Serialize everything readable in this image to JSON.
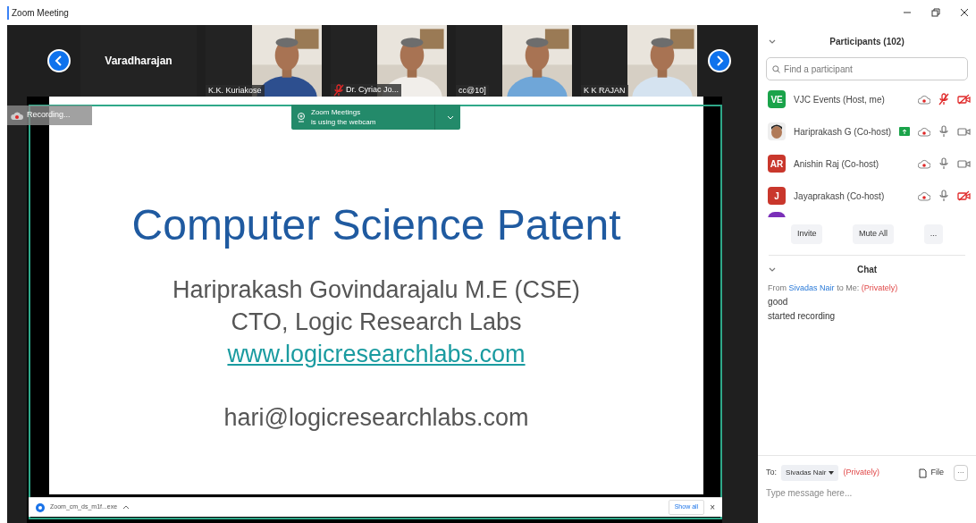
{
  "window": {
    "title": "Zoom Meeting"
  },
  "video_strip": {
    "tiles": [
      {
        "kind": "name",
        "name": "Varadharajan",
        "mic_muted": false
      },
      {
        "kind": "video",
        "name": "K.K. Kuriakose",
        "mic_muted": false
      },
      {
        "kind": "video",
        "name": "Dr. Cyriac Jo...",
        "mic_muted": true
      },
      {
        "kind": "video",
        "name": "cc@10]",
        "mic_muted": false
      },
      {
        "kind": "video",
        "name": "K K RAJAN",
        "mic_muted": false
      }
    ]
  },
  "recording_badge": {
    "label": "Recording..."
  },
  "webcam_notice": {
    "line_1": "Zoom Meetings",
    "line_2": "is using the webcam"
  },
  "slide": {
    "title": "Computer Science Patent",
    "lines": [
      "Hariprakash Govindarajalu M.E (CSE)",
      "CTO, Logic Research Labs"
    ],
    "link": "www.logicresearchlabs.com",
    "email": "hari@logicresearchlabs.com"
  },
  "download_bar": {
    "file": "Zoom_cm_ds_m1f...exe",
    "show_all": "Show all",
    "close": "×"
  },
  "participants": {
    "title": "Participants (102)",
    "search": {
      "placeholder": "Find a participant"
    },
    "items": [
      {
        "kind": "initials",
        "initials": "VE",
        "color": "#1aa34a",
        "name": "VJC Events (Host, me)",
        "sharing": false,
        "mic_muted": true,
        "video_off": true
      },
      {
        "name": "Hariprakash G (Co-host)",
        "sharing": true,
        "mic_muted": false,
        "video_off": false
      },
      {
        "kind": "initials",
        "initials": "AR",
        "color": "#c9372c",
        "name": "Anishin Raj (Co-host)",
        "sharing": false,
        "mic_muted": false,
        "video_off": false
      },
      {
        "kind": "initials",
        "initials": "J",
        "color": "#c9372c",
        "name": "Jayaprakash (Co-host)",
        "sharing": false,
        "mic_muted": false,
        "video_off": true
      },
      {
        "kind": "partial",
        "color": "#7a2fb8"
      }
    ],
    "buttons": [
      "Invite",
      "Mute All",
      "..."
    ]
  },
  "chat": {
    "title": "Chat",
    "header": {
      "from": "From",
      "sender": "Sivadas Nair",
      "to": "to Me:",
      "privacy": "(Privately)"
    },
    "messages": [
      "good",
      "started recording"
    ],
    "to_label": "To:",
    "recipient": "Sivadas Nair",
    "privacy": "(Privately)",
    "file": "File",
    "more": "···",
    "placeholder": "Type message here..."
  }
}
